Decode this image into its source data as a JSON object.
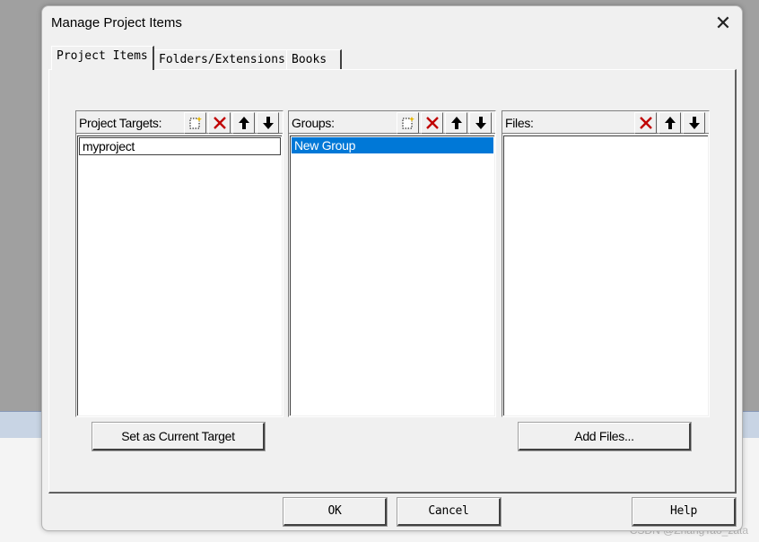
{
  "dialog": {
    "title": "Manage Project Items",
    "close_label": "✕"
  },
  "tabs": [
    {
      "label": "Project Items",
      "active": true
    },
    {
      "label": "Folders/Extensions",
      "active": false
    },
    {
      "label": "Books",
      "active": false
    }
  ],
  "targets": {
    "label": "Project Targets:",
    "items": [
      "myproject"
    ]
  },
  "groups": {
    "label": "Groups:",
    "items": [
      "New Group"
    ]
  },
  "files": {
    "label": "Files:",
    "items": []
  },
  "buttons": {
    "set_current_target": "Set as Current Target",
    "add_files": "Add Files...",
    "ok": "OK",
    "cancel": "Cancel",
    "help": "Help"
  },
  "watermark": "CSDN @ZhangTao_zata",
  "colors": {
    "selection": "#0078d7",
    "delete_icon": "#c00000"
  }
}
